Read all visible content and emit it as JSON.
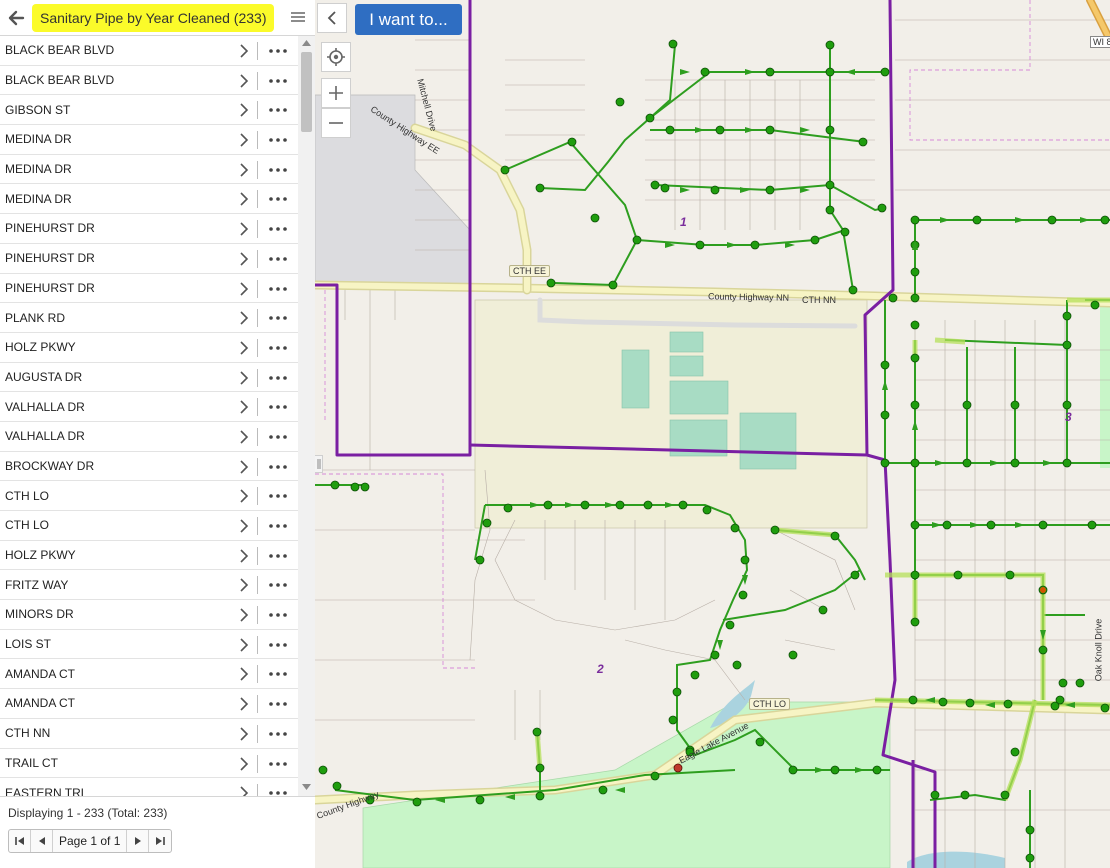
{
  "panel": {
    "title": "Sanitary Pipe by Year Cleaned (233)",
    "back_icon": "back-arrow-icon",
    "menu_icon": "hamburger-menu-icon"
  },
  "list": {
    "items": [
      {
        "label": "BLACK BEAR BLVD"
      },
      {
        "label": "BLACK BEAR BLVD"
      },
      {
        "label": "GIBSON ST"
      },
      {
        "label": "MEDINA DR"
      },
      {
        "label": "MEDINA DR"
      },
      {
        "label": "MEDINA DR"
      },
      {
        "label": "PINEHURST DR"
      },
      {
        "label": "PINEHURST DR"
      },
      {
        "label": "PINEHURST DR"
      },
      {
        "label": "PLANK RD"
      },
      {
        "label": "HOLZ PKWY"
      },
      {
        "label": "AUGUSTA DR"
      },
      {
        "label": "VALHALLA DR"
      },
      {
        "label": "VALHALLA DR"
      },
      {
        "label": "BROCKWAY DR"
      },
      {
        "label": "CTH LO"
      },
      {
        "label": "CTH LO"
      },
      {
        "label": "HOLZ PKWY"
      },
      {
        "label": "FRITZ WAY"
      },
      {
        "label": "MINORS DR"
      },
      {
        "label": "LOIS ST"
      },
      {
        "label": "AMANDA CT"
      },
      {
        "label": "AMANDA CT"
      },
      {
        "label": "CTH NN"
      },
      {
        "label": "TRAIL CT"
      },
      {
        "label": "EASTERN TRL"
      }
    ]
  },
  "footer": {
    "status": "Displaying 1 - 233 (Total: 233)",
    "page_text": "Page 1 of 1"
  },
  "map": {
    "want_button": "I want to...",
    "labels": {
      "county_hwy_nn": "County Highway NN",
      "cth_nn": "CTH NN",
      "cth_ee": "CTH EE",
      "county_hwy_ee": "County Highway EE",
      "cth_lo": "CTH LO",
      "mitchell_drive": "Mitchell Drive",
      "oak_knoll_drive": "Oak Knoll Drive",
      "eagle_lake_ave": "Eagle Lake Avenue",
      "county_hwy_lo": "County Highway",
      "district_1": "1",
      "district_2": "2",
      "district_3": "3",
      "shield_wi": "WI 8"
    }
  },
  "colors": {
    "title_highlight": "#fbfb2a",
    "want_button_bg": "#2f6ec2",
    "pipe_green": "#2e9e1f",
    "manhole_green": "#1f9d0e",
    "boundary_purple": "#7a1fa2",
    "park_green": "#c8f5c8",
    "map_background": "#f2efe9"
  }
}
